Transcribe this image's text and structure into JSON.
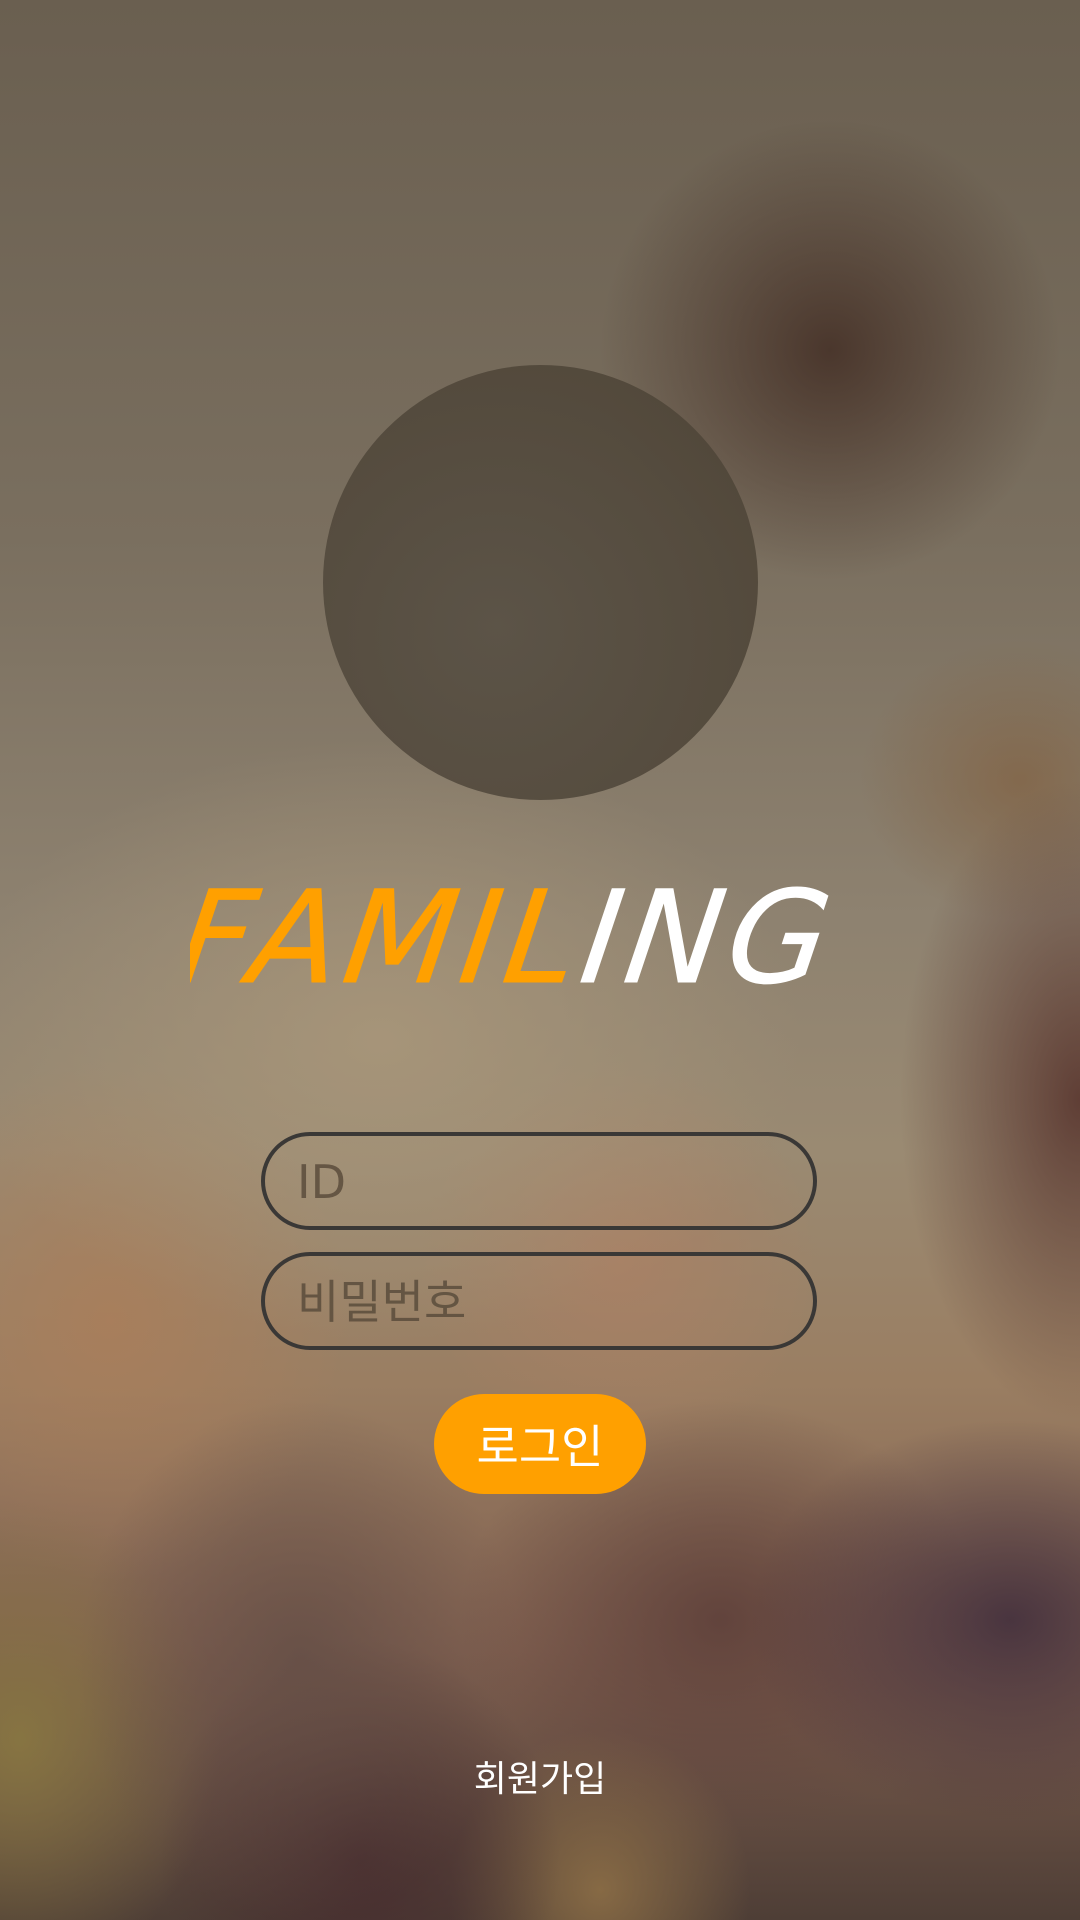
{
  "logo": {
    "text": "FAMILING",
    "part_orange": "FAMIL",
    "part_white": "ING",
    "orange_color": "#ffa000",
    "white_color": "#ffffff"
  },
  "login_form": {
    "id_placeholder": "ID",
    "password_placeholder": "비밀번호",
    "login_button_label": "로그인",
    "button_color": "#ffa000"
  },
  "signup_link": "회원가입"
}
